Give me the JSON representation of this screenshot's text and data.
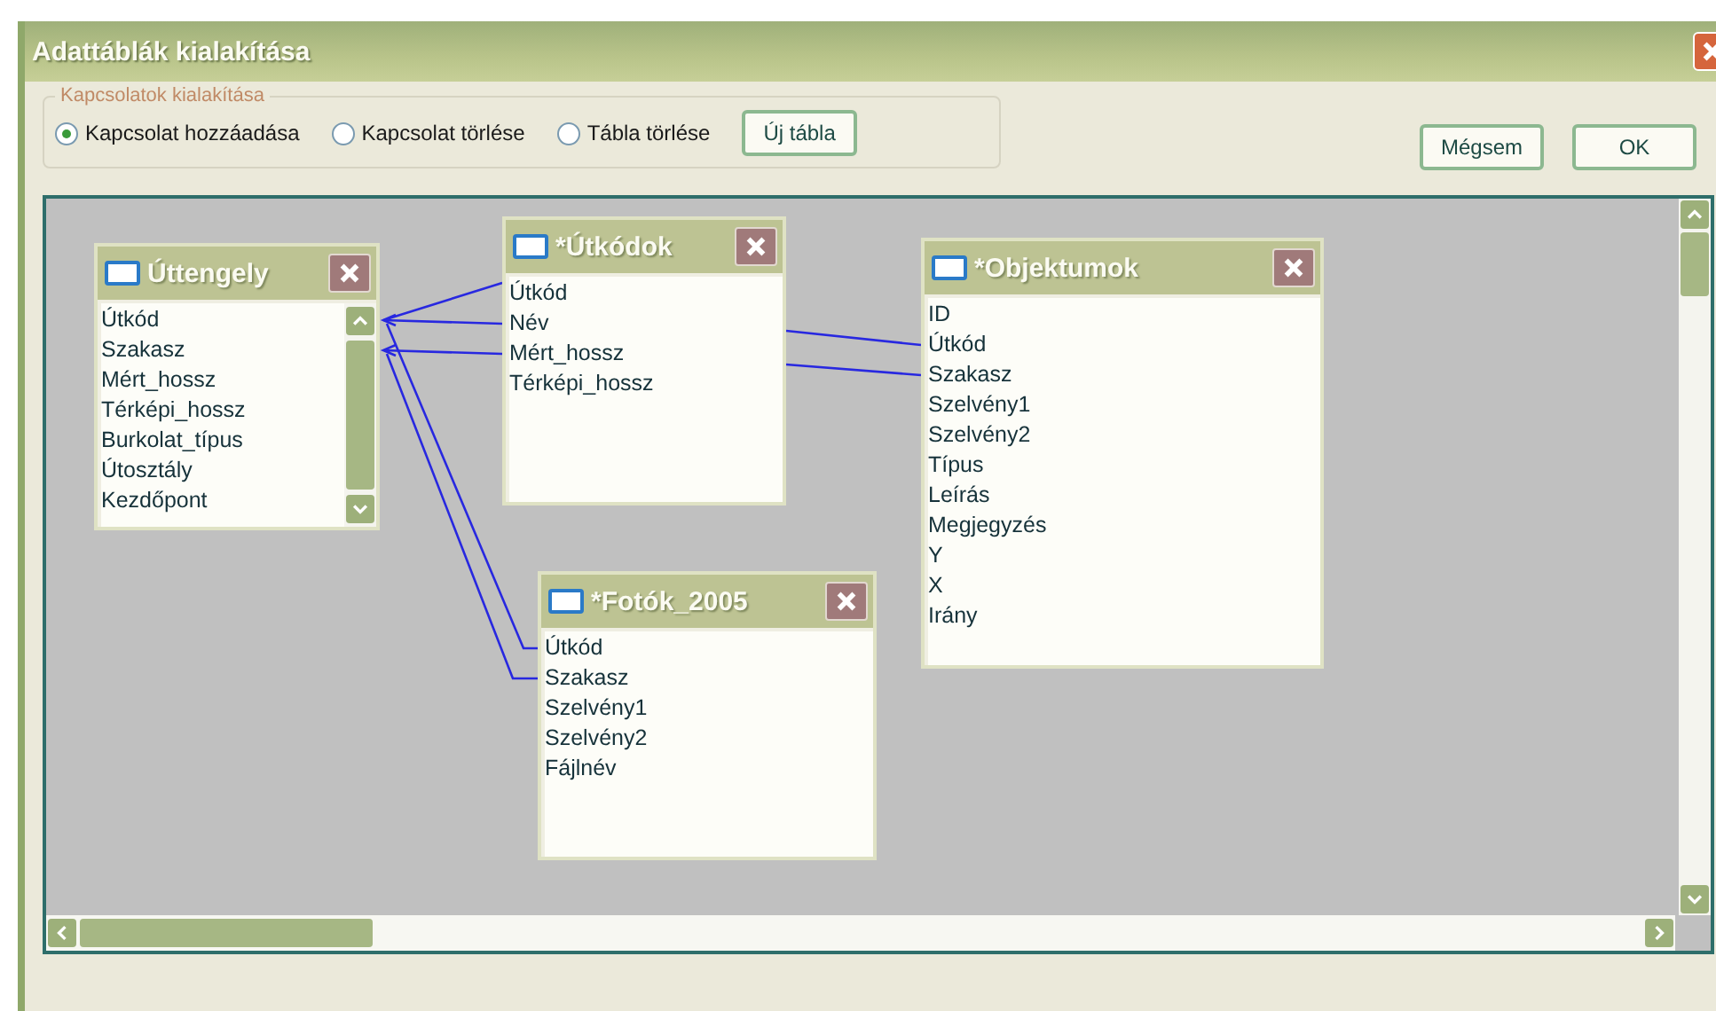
{
  "window": {
    "title": "Adattáblák kialakítása"
  },
  "relations_group": {
    "title": "Kapcsolatok kialakítása",
    "options": [
      {
        "label": "Kapcsolat hozzáadása",
        "selected": true
      },
      {
        "label": "Kapcsolat törlése",
        "selected": false
      },
      {
        "label": "Tábla törlése",
        "selected": false
      }
    ],
    "new_table_button": "Új tábla"
  },
  "buttons": [
    "Mégsem",
    "OK"
  ],
  "tables": [
    {
      "title": "Úttengely",
      "scrollbar": true,
      "fields": [
        "Útkód",
        "Szakasz",
        "Mért_hossz",
        "Térképi_hossz",
        "Burkolat_típus",
        "Útosztály",
        "Kezdőpont"
      ]
    },
    {
      "title": "*Útkódok",
      "scrollbar": false,
      "fields": [
        "Útkód",
        "Név",
        "Mért_hossz",
        "Térképi_hossz"
      ]
    },
    {
      "title": "*Objektumok",
      "scrollbar": false,
      "fields": [
        "ID",
        "Útkód",
        "Szakasz",
        "Szelvény1",
        "Szelvény2",
        "Típus",
        "Leírás",
        "Megjegyzés",
        "Y",
        "X",
        "Irány"
      ]
    },
    {
      "title": "*Fotók_2005",
      "scrollbar": false,
      "fields": [
        "Útkód",
        "Szakasz",
        "Szelvény1",
        "Szelvény2",
        "Fájlnév"
      ]
    }
  ]
}
